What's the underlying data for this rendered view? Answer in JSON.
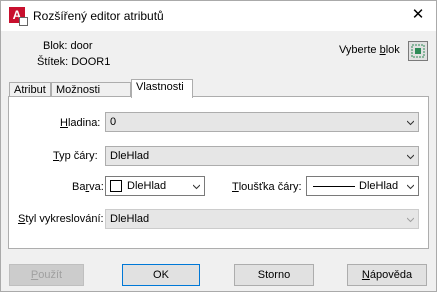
{
  "window": {
    "title": "Rozšířený editor atributů",
    "icon_letter": "A",
    "close_symbol": "✕"
  },
  "info": {
    "block_label": "Blok: door",
    "tag_label": "Štítek: DOOR1",
    "select_block_label": "Vyberte blok"
  },
  "tabs": [
    {
      "label": "Atribut",
      "active": false
    },
    {
      "label": "Možnosti textu",
      "active": false
    },
    {
      "label": "Vlastnosti",
      "active": true
    }
  ],
  "properties": {
    "layer": {
      "label": "Hladina:",
      "value": "0"
    },
    "linetype": {
      "label": "Typ čáry:",
      "value": "DleHlad"
    },
    "color": {
      "label": "Barva:",
      "value": "DleHlad"
    },
    "lineweight": {
      "label": "Tloušťka čáry:",
      "value": "DleHlad"
    },
    "plotstyle": {
      "label": "Styl vykreslování:",
      "value": "DleHlad"
    }
  },
  "buttons": {
    "apply": "Použít",
    "ok": "OK",
    "cancel": "Storno",
    "help": "Nápověda"
  },
  "colors": {
    "accent": "#0078d7",
    "brand": "#c8102e"
  }
}
